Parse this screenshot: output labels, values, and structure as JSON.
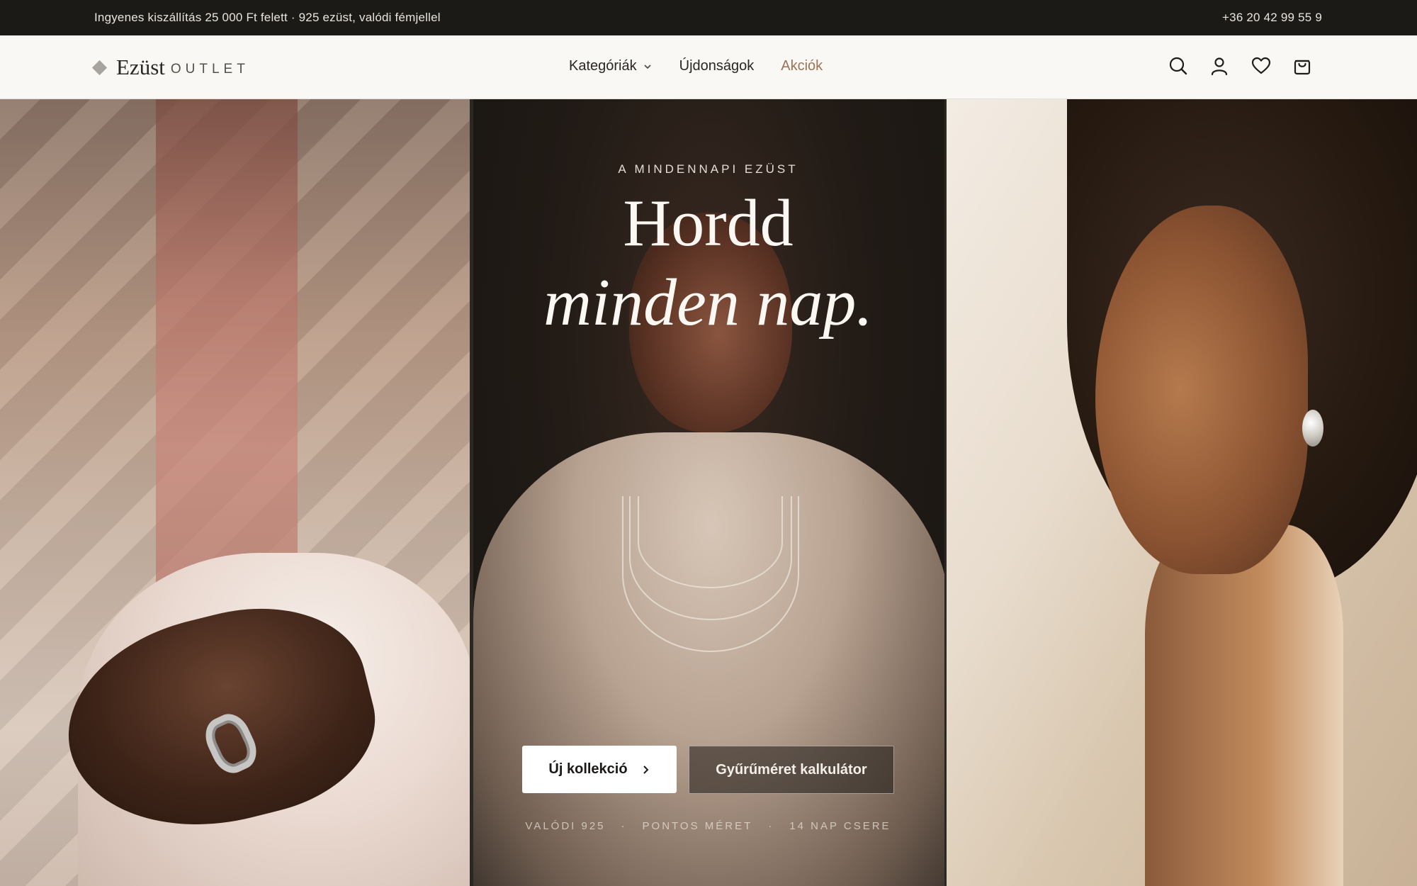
{
  "announcement": {
    "promo": "Ingyenes kiszállítás 25 000 Ft felett · 925 ezüst, valódi fémjellel",
    "phone": "+36 20 42 99 55 9"
  },
  "header": {
    "logo": {
      "name": "Ezüst",
      "suffix": "OUTLET"
    },
    "nav": [
      {
        "label": "Kategóriák",
        "icon": "chevron-down-icon"
      },
      {
        "label": "Újdonságok"
      },
      {
        "label": "Akciók"
      }
    ],
    "icons": [
      "search-icon",
      "user-icon",
      "heart-icon",
      "bag-icon"
    ],
    "accent_color": "#9a7358"
  },
  "hero": {
    "eyebrow": "A MINDENNAPI EZÜST",
    "headline_line1": "Hordd",
    "headline_line2": "minden nap.",
    "primary_cta": "Új kollekció",
    "secondary_cta": "Gyűrűméret kalkulátor",
    "usps": [
      "VALÓDI 925",
      "PONTOS MÉRET",
      "14 NAP CSERE"
    ]
  }
}
